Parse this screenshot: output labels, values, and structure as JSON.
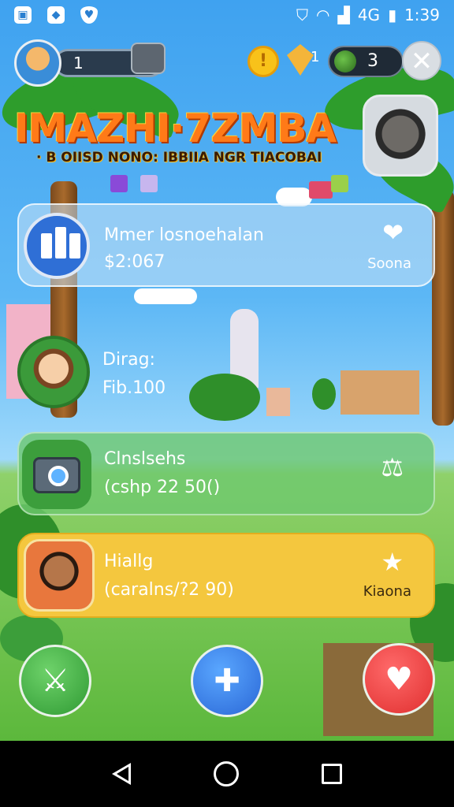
{
  "status_bar": {
    "time": "1:39",
    "signal": "4G"
  },
  "hud": {
    "level": "1",
    "gem_count": "1",
    "bomb_count": "3",
    "close_symbol": "✕"
  },
  "title": {
    "main": "IMAZHI·7ZMBA",
    "subtitle": "· B OIISD NONO: IBBIIA NGR TIACOBAI"
  },
  "cards": [
    {
      "label": "Mmer losnoehalan",
      "value": "$2:067",
      "right_label": "Soona",
      "right_icon": "❤"
    },
    {
      "label": "Dirag:",
      "value": "Fib.100"
    },
    {
      "label": "Clnslsehs",
      "value": "(cshp 22 50()",
      "right_icon": "⚖"
    },
    {
      "label": "Hiallg",
      "value": "(caralns/?2 90)",
      "right_label": "Kiaona",
      "right_icon": "★"
    }
  ],
  "actions": {
    "sword": "sword-icon",
    "heal": "syringe-icon",
    "heart": "heart-icon"
  },
  "colors": {
    "sky": "#5cb7f5",
    "grass": "#5cb83c",
    "card_gold": "#f4c73e",
    "card_green": "#6ec86e",
    "title_orange": "#ff7a18"
  }
}
